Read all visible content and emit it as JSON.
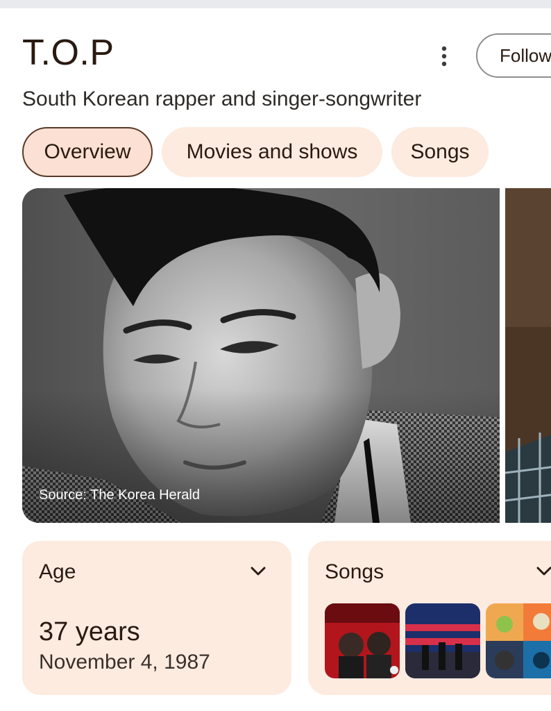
{
  "header": {
    "title": "T.O.P",
    "subtitle": "South Korean rapper and singer-songwriter",
    "follow_label": "Follow"
  },
  "tabs": [
    {
      "label": "Overview",
      "active": true
    },
    {
      "label": "Movies and shows",
      "active": false
    },
    {
      "label": "Songs",
      "active": false
    }
  ],
  "photo": {
    "source_label": "Source: The Korea Herald"
  },
  "cards": {
    "age": {
      "heading": "Age",
      "value": "37 years",
      "date": "November 4, 1987"
    },
    "songs": {
      "heading": "Songs"
    }
  },
  "icons": {
    "more": "more-vert-icon",
    "chevron": "chevron-down-icon"
  },
  "colors": {
    "accent_bg": "#fdebe0",
    "active_tab_border": "#5a3a2a",
    "text": "#2a1a10"
  }
}
